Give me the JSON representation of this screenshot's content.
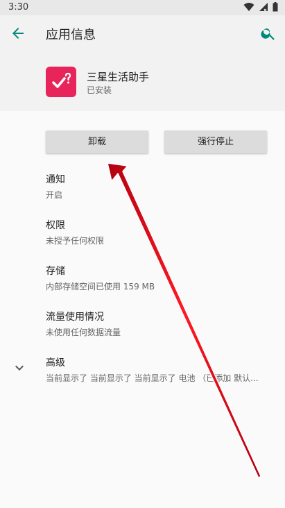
{
  "status_bar": {
    "time": "3:30",
    "icons": [
      "wifi-icon",
      "signal-icon",
      "battery-icon"
    ]
  },
  "app_bar": {
    "title": "应用信息",
    "back_icon": "arrow-back-icon",
    "search_icon": "search-icon"
  },
  "app": {
    "name": "三星生活助手",
    "status": "已安装",
    "icon_color": "#e8255b"
  },
  "buttons": {
    "uninstall": "卸载",
    "force_stop": "强行停止"
  },
  "settings": [
    {
      "title": "通知",
      "subtitle": "开启"
    },
    {
      "title": "权限",
      "subtitle": "未授予任何权限"
    },
    {
      "title": "存储",
      "subtitle": "内部存储空间已使用 159 MB"
    },
    {
      "title": "流量使用情况",
      "subtitle": "未使用任何数据流量"
    },
    {
      "title": "高级",
      "subtitle": "当前显示了 当前显示了 当前显示了 电池 （已添加 默认..."
    }
  ],
  "colors": {
    "accent": "#00897b",
    "annotation_arrow": "#e8101a"
  }
}
